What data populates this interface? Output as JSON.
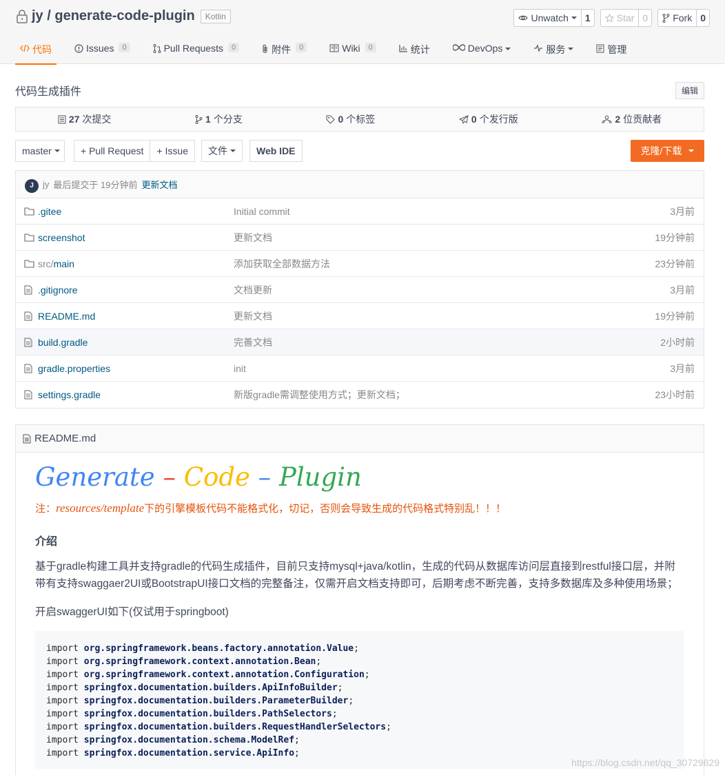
{
  "repo": {
    "owner": "jy",
    "sep": " / ",
    "name": "generate-code-plugin",
    "lang": "Kotlin"
  },
  "actions": {
    "watch": {
      "label": "Unwatch",
      "count": "1"
    },
    "star": {
      "label": "Star",
      "count": "0"
    },
    "fork": {
      "label": "Fork",
      "count": "0"
    }
  },
  "tabs": [
    {
      "label": "代码",
      "badge": ""
    },
    {
      "label": "Issues",
      "badge": "0"
    },
    {
      "label": "Pull Requests",
      "badge": "0"
    },
    {
      "label": "附件",
      "badge": "0"
    },
    {
      "label": "Wiki",
      "badge": "0"
    },
    {
      "label": "统计",
      "badge": ""
    },
    {
      "label": "DevOps",
      "badge": ""
    },
    {
      "label": "服务",
      "badge": ""
    },
    {
      "label": "管理",
      "badge": ""
    }
  ],
  "description": "代码生成插件",
  "edit_label": "编辑",
  "stats": {
    "commits": {
      "num": "27",
      "label": "次提交"
    },
    "branches": {
      "num": "1",
      "label": "个分支"
    },
    "tags": {
      "num": "0",
      "label": "个标签"
    },
    "releases": {
      "num": "0",
      "label": "个发行版"
    },
    "contributors": {
      "num": "2",
      "label": "位贡献者"
    }
  },
  "toolbar": {
    "branch": "master",
    "pull_request": "+ Pull Request",
    "issue": "+ Issue",
    "file": "文件",
    "webide": "Web IDE",
    "clone": "克隆/下载"
  },
  "last_commit": {
    "avatar": "J",
    "author": "jy",
    "text": "最后提交于 19分钟前",
    "message": "更新文档"
  },
  "files": [
    {
      "prefix": "",
      "name": ".gitee",
      "type": "folder",
      "message": "Initial commit",
      "time": "3月前"
    },
    {
      "prefix": "",
      "name": "screenshot",
      "type": "folder",
      "message": "更新文档",
      "time": "19分钟前"
    },
    {
      "prefix": "src/",
      "name": "main",
      "type": "folder",
      "message": "添加获取全部数据方法",
      "time": "23分钟前"
    },
    {
      "prefix": "",
      "name": ".gitignore",
      "type": "file",
      "message": "文档更新",
      "time": "3月前"
    },
    {
      "prefix": "",
      "name": "README.md",
      "type": "file",
      "message": "更新文档",
      "time": "19分钟前"
    },
    {
      "prefix": "",
      "name": "build.gradle",
      "type": "file",
      "message": "完善文档",
      "time": "2小时前"
    },
    {
      "prefix": "",
      "name": "gradle.properties",
      "type": "file",
      "message": "init",
      "time": "3月前"
    },
    {
      "prefix": "",
      "name": "settings.gradle",
      "type": "file",
      "message": "新版gradle需调整使用方式；更新文档；",
      "time": "23小时前"
    }
  ],
  "readme": {
    "filename": "README.md",
    "title": {
      "w1": "Generate",
      "d1": " – ",
      "w2": "Code",
      "d2": " – ",
      "w3": "Plugin"
    },
    "warn_prefix": "注：",
    "warn_path": "resources/template",
    "warn_suffix": "下的引擎模板代码不能格式化，切记，否则会导致生成的代码格式特别乱！！！",
    "intro_heading": "介绍",
    "intro_text": "基于gradle构建工具并支持gradle的代码生成插件，目前只支持mysql+java/kotlin，生成的代码从数据库访问层直接到restful接口层，并附带有支持swaggaer2UI或BootstrapUI接口文档的完整备注，仅需开启文档支持即可，后期考虑不断完善，支持多数据库及多种使用场景；",
    "swagger_text": "开启swaggerUI如下(仅试用于springboot)",
    "code_lines": [
      {
        "kw": "import",
        "pkg": "org.springframework.beans.factory.annotation.Value",
        "end": ";"
      },
      {
        "kw": "import",
        "pkg": "org.springframework.context.annotation.Bean",
        "end": ";"
      },
      {
        "kw": "import",
        "pkg": "org.springframework.context.annotation.Configuration",
        "end": ";"
      },
      {
        "kw": "import",
        "pkg": "springfox.documentation.builders.ApiInfoBuilder",
        "end": ";"
      },
      {
        "kw": "import",
        "pkg": "springfox.documentation.builders.ParameterBuilder",
        "end": ";"
      },
      {
        "kw": "import",
        "pkg": "springfox.documentation.builders.PathSelectors",
        "end": ";"
      },
      {
        "kw": "import",
        "pkg": "springfox.documentation.builders.RequestHandlerSelectors",
        "end": ";"
      },
      {
        "kw": "import",
        "pkg": "springfox.documentation.schema.ModelRef",
        "end": ";"
      },
      {
        "kw": "import",
        "pkg": "springfox.documentation.service.ApiInfo",
        "end": ";"
      }
    ]
  },
  "watermark": "https://blog.csdn.net/qq_30729829",
  "colors": {
    "accent": "#fe7300",
    "link": "#005980",
    "clone_bg": "#f36b22"
  }
}
